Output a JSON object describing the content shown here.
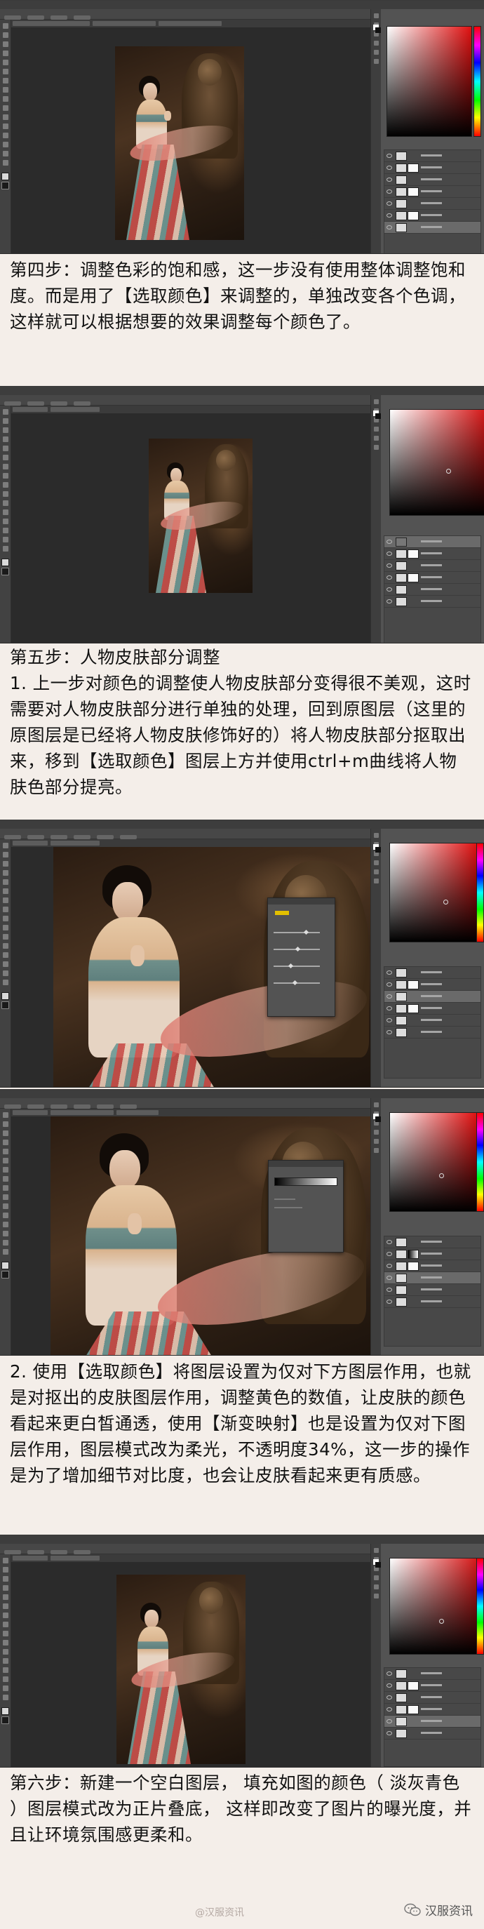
{
  "steps": [
    {
      "paragraphs": [
        "第四步：调整色彩的饱和感，这一步没有使用整体调整饱和度。而是用了【选取颜色】来调整的，单独改变各个色调，这样就可以根据想要的效果调整每个颜色了。"
      ]
    },
    {
      "paragraphs": [
        "第五步：人物皮肤部分调整",
        "1.   上一步对颜色的调整使人物皮肤部分变得很不美观，这时需要对人物皮肤部分进行单独的处理，回到原图层（这里的原图层是已经将人物皮肤修饰好的）将人物皮肤部分抠取出来，移到【选取颜色】图层上方并使用ctrl+m曲线将人物肤色部分提亮。"
      ]
    },
    {
      "paragraphs": [
        "2.   使用【选取颜色】将图层设置为仅对下方图层作用，也就是对抠出的皮肤图层作用，调整黄色的数值，让皮肤的颜色看起来更白皙通透，使用【渐变映射】也是设置为仅对下图层作用，图层模式改为柔光，不透明度34%，这一步的操作是为了增加细节对比度，也会让皮肤看起来更有质感。"
      ]
    },
    {
      "paragraphs": [
        "第六步：新建一个空白图层，  填充如图的颜色（ 淡灰青色 ）图层模式改为正片叠底，  这样即改变了图片的曝光度，并且让环境氛围感更柔和。"
      ]
    }
  ],
  "footer": {
    "watermark": "@汉服资讯",
    "brand": "汉服资讯"
  },
  "colors": {
    "page_bg": "#f4eee9",
    "ps_bg": "#535353",
    "canvas_bg": "#2b2b2b",
    "picker_hue": "#e01010"
  }
}
